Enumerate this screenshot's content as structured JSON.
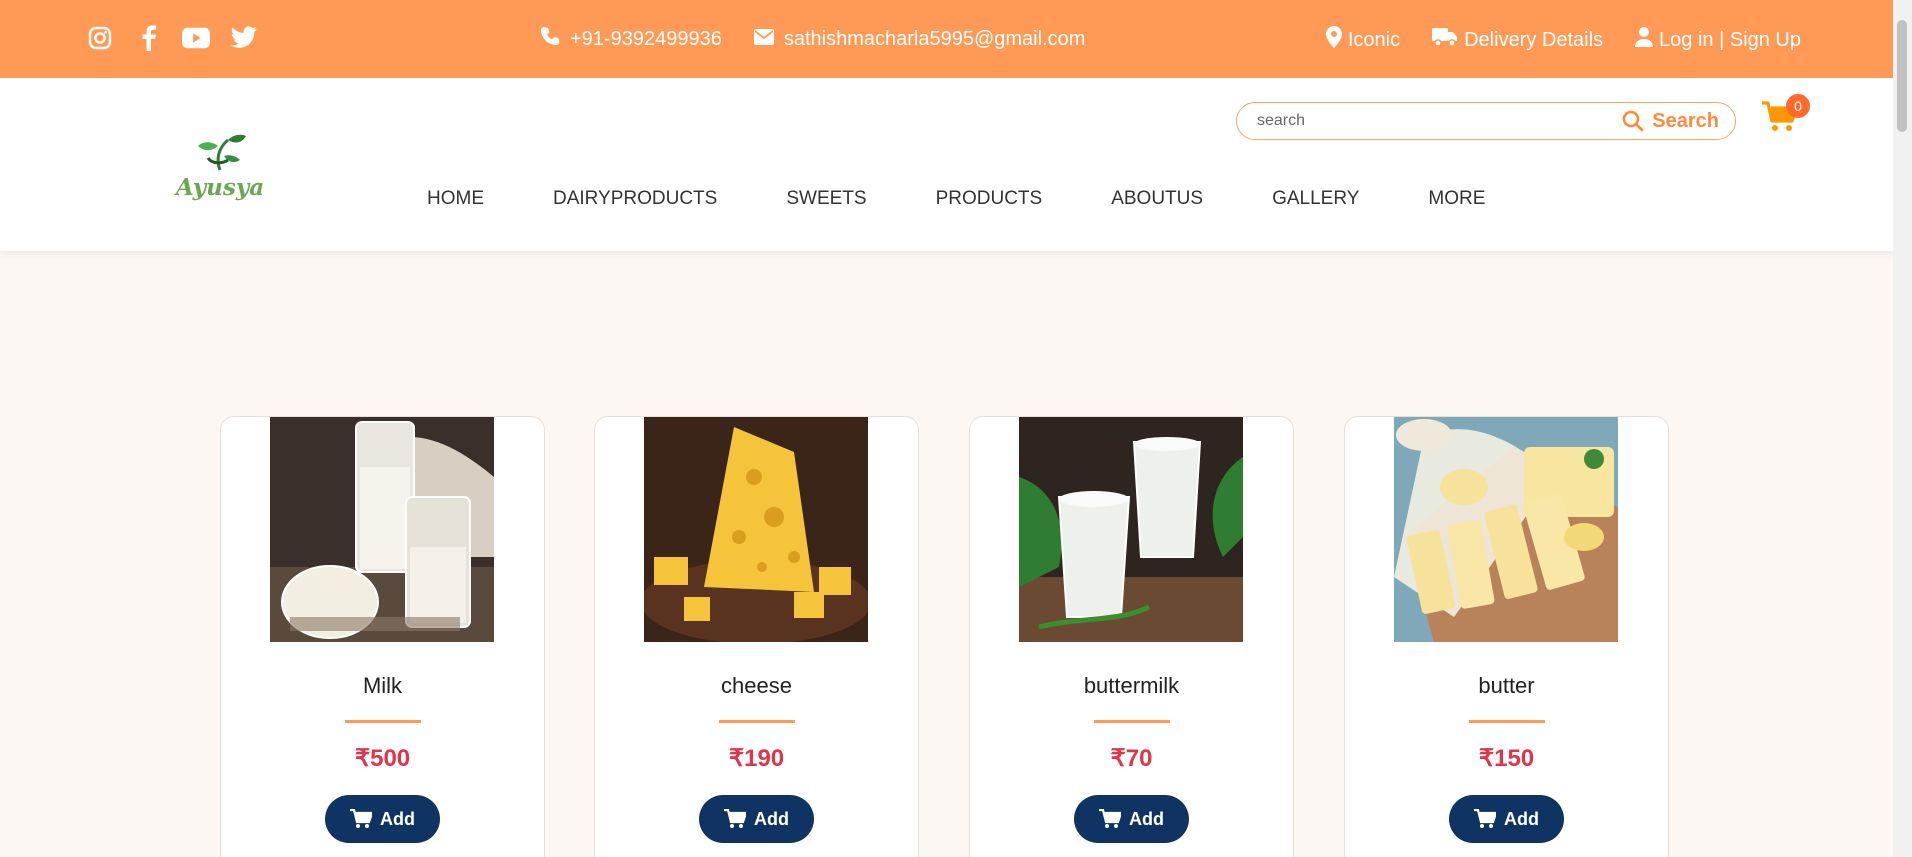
{
  "topbar": {
    "social": [
      "instagram-icon",
      "facebook-icon",
      "youtube-icon",
      "twitter-icon"
    ],
    "phone": "+91-9392499936",
    "email": "sathishmacharla5995@gmail.com",
    "location": "Iconic",
    "delivery": "Delivery Details",
    "auth": "Log in | Sign Up",
    "bg_color": "#ff9a56"
  },
  "header": {
    "logo_text": "Ayusya",
    "nav": [
      "HOME",
      "DAIRYPRODUCTS",
      "SWEETS",
      "PRODUCTS",
      "ABOUTUS",
      "GALLERY",
      "MORE"
    ],
    "search": {
      "placeholder": "search",
      "button_label": "Search"
    },
    "cart_count": "0"
  },
  "products": [
    {
      "name": "Milk",
      "price": "₹500",
      "button": "Add",
      "image": "milk-image"
    },
    {
      "name": "cheese",
      "price": "₹190",
      "button": "Add",
      "image": "cheese-image"
    },
    {
      "name": "buttermilk",
      "price": "₹70",
      "button": "Add",
      "image": "buttermilk-image"
    },
    {
      "name": "butter",
      "price": "₹150",
      "button": "Add",
      "image": "butter-image"
    }
  ],
  "colors": {
    "accent": "#ff9a56",
    "price": "#e0344a",
    "button": "#0f3463"
  }
}
